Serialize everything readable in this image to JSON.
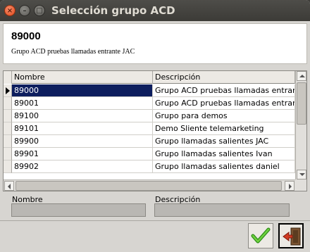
{
  "window": {
    "title": "Selección grupo ACD",
    "controls": {
      "close": "×",
      "minimize": "–",
      "maximize": "□"
    }
  },
  "header": {
    "code": "89000",
    "description": "Grupo ACD pruebas llamadas entrante JAC"
  },
  "table": {
    "columns": [
      "Nombre",
      "Descripción"
    ],
    "selected_index": 0,
    "rows": [
      {
        "nombre": "89000",
        "descripcion": "Grupo ACD pruebas llamadas entrante"
      },
      {
        "nombre": "89001",
        "descripcion": "Grupo ACD pruebas llamadas entrante"
      },
      {
        "nombre": "89100",
        "descripcion": "Grupo para demos"
      },
      {
        "nombre": "89101",
        "descripcion": "Demo Sliente telemarketing"
      },
      {
        "nombre": "89900",
        "descripcion": "Grupo llamadas salientes JAC"
      },
      {
        "nombre": "89901",
        "descripcion": "Grupo llamadas salientes Ivan"
      },
      {
        "nombre": "89902",
        "descripcion": "Grupo llamadas salientes daniel"
      }
    ]
  },
  "filters": {
    "nombre_label": "Nombre",
    "nombre_value": "",
    "descripcion_label": "Descripción",
    "descripcion_value": ""
  },
  "actions": {
    "accept_icon": "checkmark-icon",
    "exit_icon": "exit-door-icon"
  },
  "colors": {
    "selection": "#0d1e5e",
    "titlebar": "#3c3b37",
    "close_button": "#e2491c",
    "accept_green": "#3da81e",
    "exit_red": "#c0281c"
  }
}
